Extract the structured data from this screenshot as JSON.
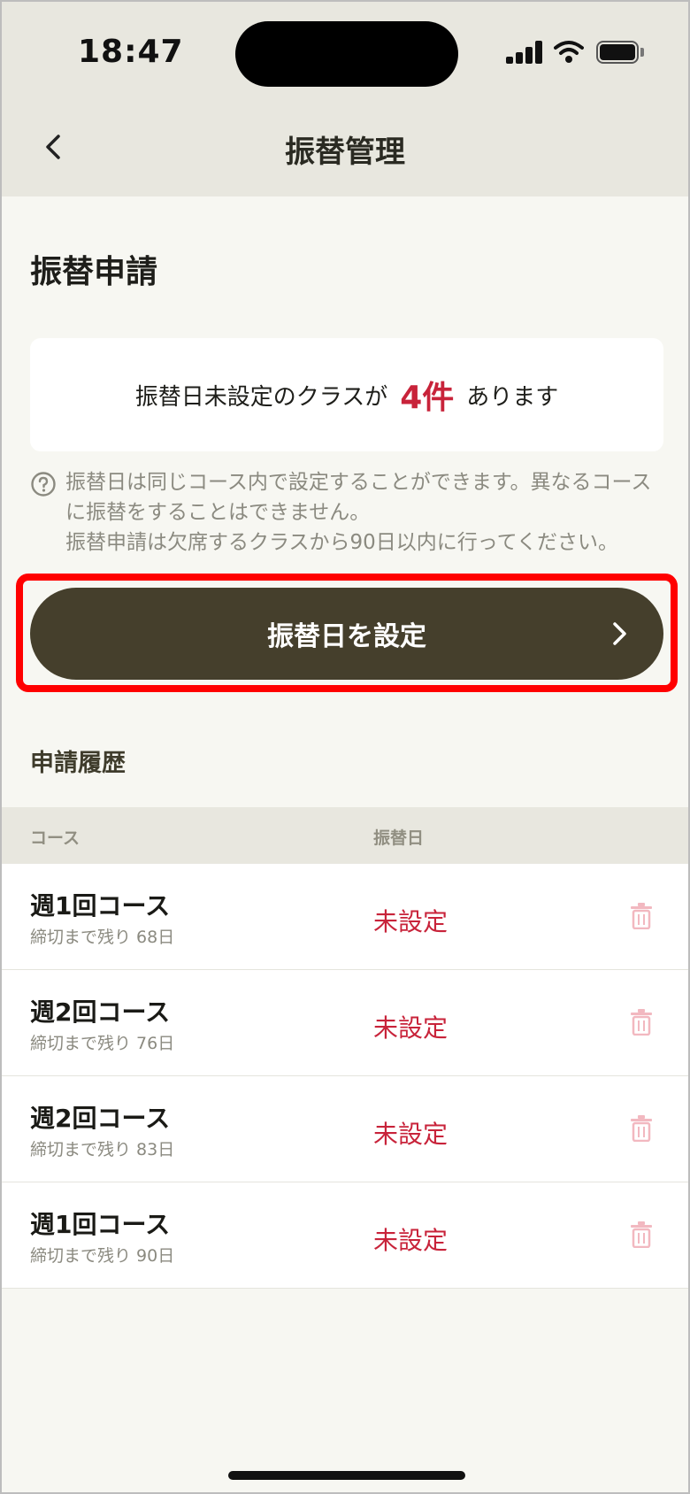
{
  "status_bar": {
    "time": "18:47"
  },
  "nav": {
    "title": "振替管理"
  },
  "section": {
    "title": "振替申請"
  },
  "notice": {
    "prefix": "振替日未設定のクラスが",
    "count": "4件",
    "suffix": "あります"
  },
  "help": {
    "lines": [
      "振替日は同じコース内で設定することができます。異なるコースに振替をすることはできません。",
      "振替申請は欠席するクラスから90日以内に行ってください。"
    ]
  },
  "primary_button": {
    "label": "振替日を設定"
  },
  "history": {
    "title": "申請履歴",
    "columns": {
      "course": "コース",
      "date": "振替日"
    },
    "rows": [
      {
        "course": "週1回コース",
        "deadline": "締切まで残り 68日",
        "status": "未設定"
      },
      {
        "course": "週2回コース",
        "deadline": "締切まで残り 76日",
        "status": "未設定"
      },
      {
        "course": "週2回コース",
        "deadline": "締切まで残り 83日",
        "status": "未設定"
      },
      {
        "course": "週1回コース",
        "deadline": "締切まで残り 90日",
        "status": "未設定"
      }
    ]
  },
  "colors": {
    "accent_red": "#c8233a",
    "button_brown": "#453f2c",
    "header_bg": "#e8e7df",
    "highlight_red": "#ff0000"
  },
  "icons": [
    "back-chevron-icon",
    "help-question-icon",
    "chevron-right-icon",
    "trash-icon",
    "signal-icon",
    "wifi-icon",
    "battery-icon"
  ]
}
